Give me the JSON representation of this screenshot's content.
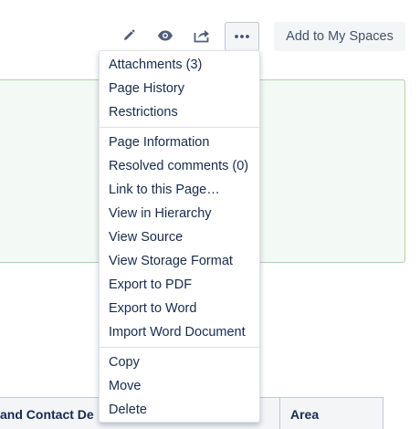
{
  "toolbar": {
    "edit_icon": "pencil-icon",
    "watch_icon": "eye-icon",
    "share_icon": "share-icon",
    "more_icon": "more-horizontal-icon",
    "add_to_spaces_label": "Add to My Spaces"
  },
  "table": {
    "headers": [
      "and Contact De",
      "Area"
    ]
  },
  "menu": {
    "groups": [
      [
        "Attachments (3)",
        "Page History",
        "Restrictions"
      ],
      [
        "Page Information",
        "Resolved comments (0)",
        "Link to this Page…",
        "View in Hierarchy",
        "View Source",
        "View Storage Format",
        "Export to PDF",
        "Export to Word",
        "Import Word Document"
      ],
      [
        "Copy",
        "Move",
        "Delete"
      ]
    ]
  },
  "colors": {
    "panel_background": "#f3f9f4",
    "panel_border": "#abd5a7",
    "text": "#172b4d"
  }
}
